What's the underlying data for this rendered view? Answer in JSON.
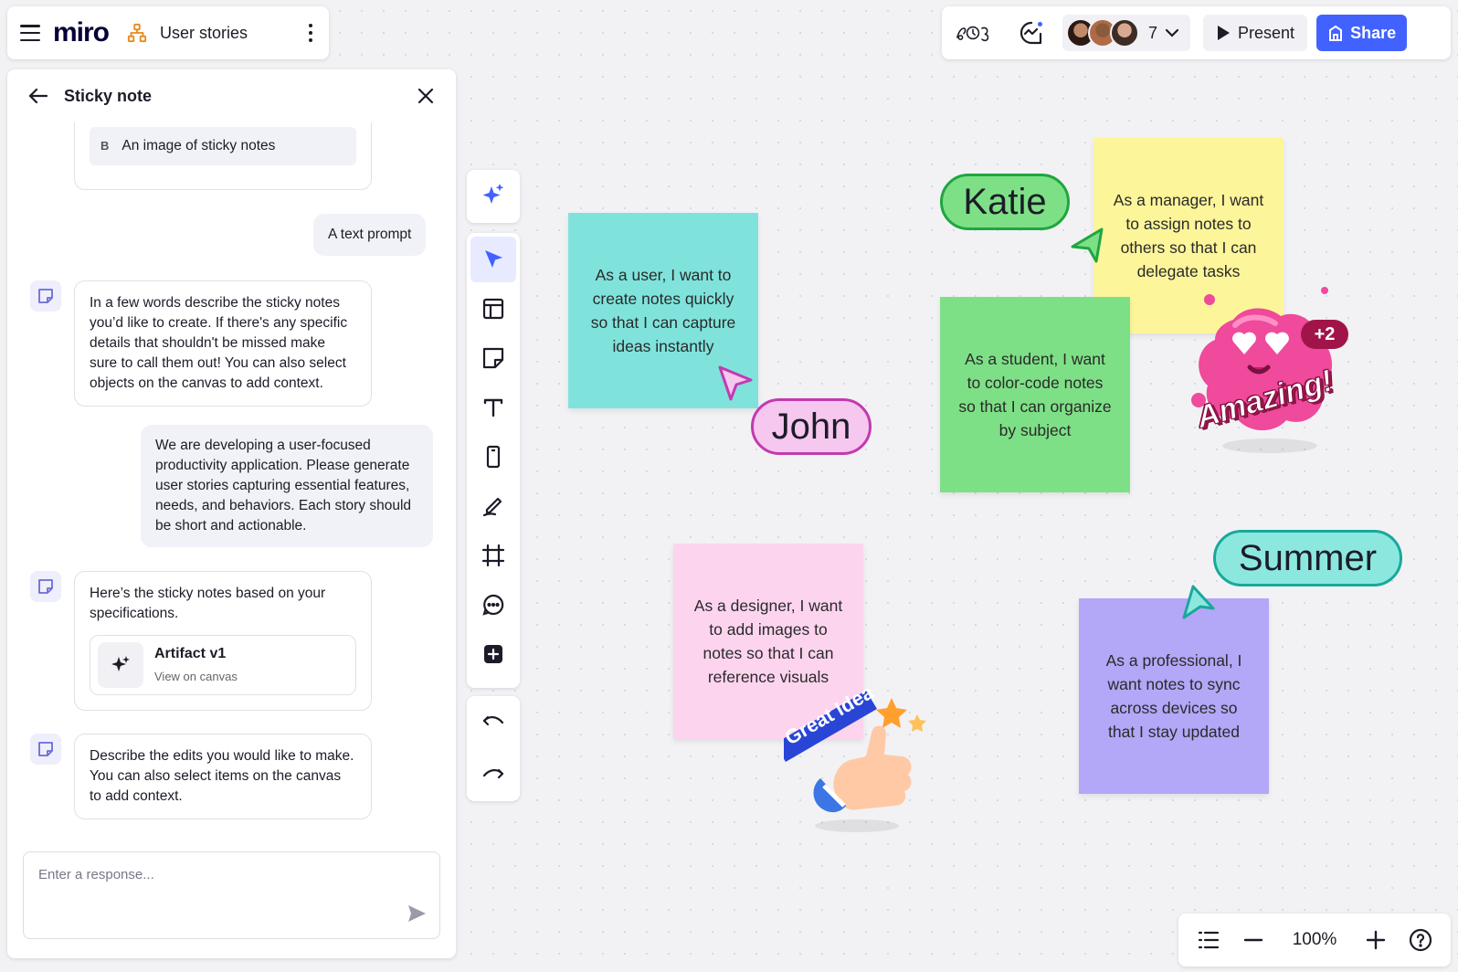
{
  "app": {
    "logo": "miro",
    "board_title": "User stories"
  },
  "header": {
    "collaborator_count": "7",
    "present_label": "Present",
    "share_label": "Share",
    "accent": "#4262ff"
  },
  "panel": {
    "title": "Sticky note",
    "option_b": {
      "letter": "B",
      "text": "An image of sticky notes"
    },
    "messages": [
      {
        "from": "user",
        "text": "A text prompt"
      },
      {
        "from": "ai",
        "text": "In a few words describe the sticky notes you’d like to create. If there's any specific details that shouldn't be missed make sure to call them out! You can also select objects on the canvas to add context."
      },
      {
        "from": "user",
        "text": "We are developing a user-focused productivity application. Please generate user stories capturing essential features, needs, and behaviors. Each story should be short and actionable."
      },
      {
        "from": "ai",
        "text": "Here’s the sticky notes based on your specifications."
      },
      {
        "from": "ai",
        "text": "Describe the edits you would like to make. You can also select items on the canvas to add context."
      }
    ],
    "artifact": {
      "title": "Artifact v1",
      "subtitle": "View on canvas"
    },
    "input_placeholder": "Enter a response..."
  },
  "toolbar": [
    "ai-sparkle-icon",
    "select-icon",
    "template-icon",
    "sticky-note-icon",
    "text-icon",
    "shape-icon",
    "pen-icon",
    "frame-icon",
    "comment-icon",
    "add-more-icon",
    "undo-icon",
    "redo-icon"
  ],
  "canvas": {
    "stickies": [
      {
        "text": "As a user, I want to create notes quickly so that I can capture ideas instantly",
        "color": "#7fe3dc"
      },
      {
        "text": "As a manager, I want to assign notes to others so that I can delegate tasks",
        "color": "#fdf59a"
      },
      {
        "text": "As a student, I want to color-code notes so that I can organize by subject",
        "color": "#7ee086"
      },
      {
        "text": "As a designer, I want to add images to notes so that I can reference visuals",
        "color": "#fdd4ee"
      },
      {
        "text": "As a professional, I want notes to sync across devices so that I stay updated",
        "color": "#b3a7f7"
      }
    ],
    "cursors": [
      {
        "name": "Katie",
        "color": "#1fa640",
        "fill": "#7ee086"
      },
      {
        "name": "John",
        "color": "#c33ab0",
        "fill": "#f6c7ef"
      },
      {
        "name": "Summer",
        "color": "#1aa89a",
        "fill": "#8ce8df"
      }
    ],
    "stickers": {
      "amazing": "Amazing!",
      "plus_count": "+2",
      "great_idea": "Great Idea"
    }
  },
  "zoom": {
    "level": "100%"
  }
}
